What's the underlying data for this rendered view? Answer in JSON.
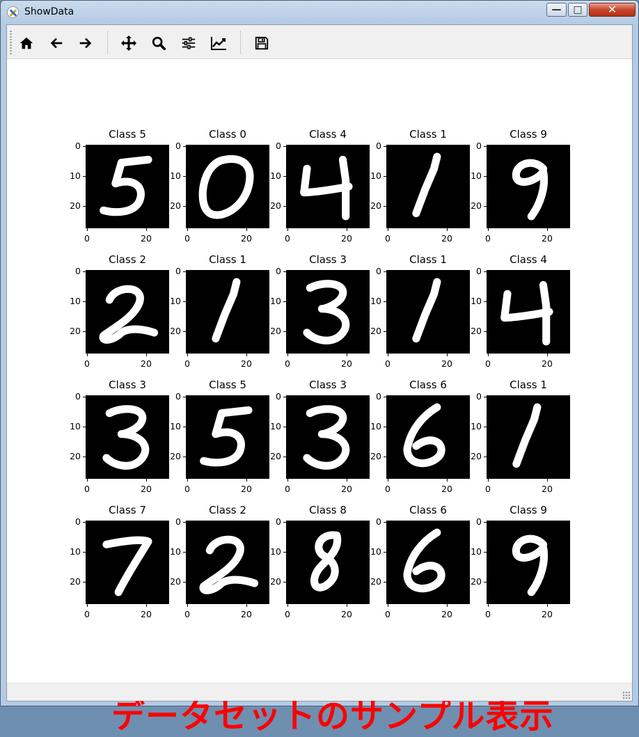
{
  "window": {
    "title": "ShowData",
    "controls": {
      "minimize": "—",
      "maximize": "□",
      "close": "✕"
    }
  },
  "toolbar": {
    "buttons": [
      {
        "name": "home-icon",
        "label": "Home"
      },
      {
        "name": "back-arrow-icon",
        "label": "Back"
      },
      {
        "name": "forward-arrow-icon",
        "label": "Forward"
      },
      {
        "name": "pan-icon",
        "label": "Pan"
      },
      {
        "name": "zoom-icon",
        "label": "Zoom"
      },
      {
        "name": "configure-subplots-icon",
        "label": "Subplots"
      },
      {
        "name": "edit-axis-icon",
        "label": "Customize"
      },
      {
        "name": "save-icon",
        "label": "Save"
      }
    ]
  },
  "figure": {
    "yticks": [
      "0",
      "10",
      "20"
    ],
    "xticks": [
      "0",
      "20"
    ],
    "subplots": [
      {
        "title": "Class 5",
        "digit": "5"
      },
      {
        "title": "Class 0",
        "digit": "0"
      },
      {
        "title": "Class 4",
        "digit": "4"
      },
      {
        "title": "Class 1",
        "digit": "1"
      },
      {
        "title": "Class 9",
        "digit": "9"
      },
      {
        "title": "Class 2",
        "digit": "2"
      },
      {
        "title": "Class 1",
        "digit": "1"
      },
      {
        "title": "Class 3",
        "digit": "3"
      },
      {
        "title": "Class 1",
        "digit": "1"
      },
      {
        "title": "Class 4",
        "digit": "4"
      },
      {
        "title": "Class 3",
        "digit": "3"
      },
      {
        "title": "Class 5",
        "digit": "5"
      },
      {
        "title": "Class 3",
        "digit": "3"
      },
      {
        "title": "Class 6",
        "digit": "6"
      },
      {
        "title": "Class 1",
        "digit": "1"
      },
      {
        "title": "Class 7",
        "digit": "7"
      },
      {
        "title": "Class 2",
        "digit": "2"
      },
      {
        "title": "Class 8",
        "digit": "8"
      },
      {
        "title": "Class 6",
        "digit": "6"
      },
      {
        "title": "Class 9",
        "digit": "9"
      }
    ]
  },
  "caption": "データセットのサンプル表示",
  "colors": {
    "caption": "#ff0000",
    "image_bg": "#000000",
    "digit": "#ffffff"
  }
}
